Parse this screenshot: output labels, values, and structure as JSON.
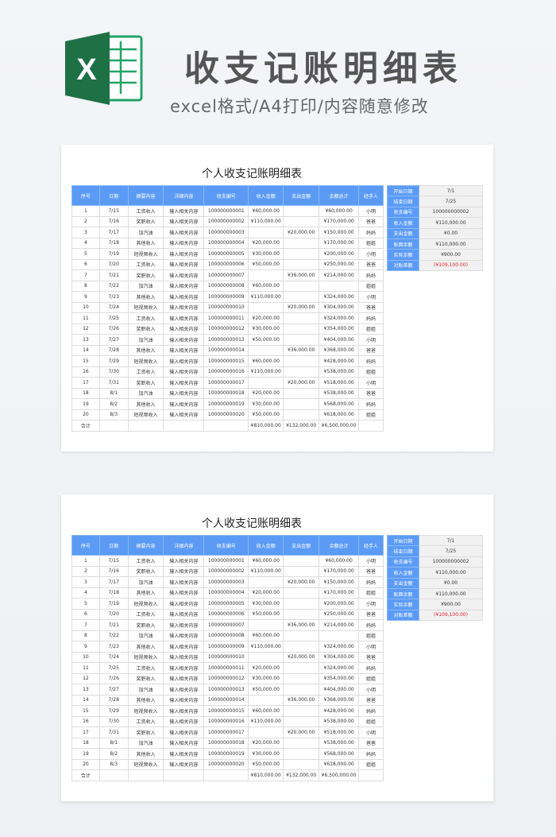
{
  "header": {
    "title": "收支记账明细表",
    "subtitle": "excel格式/A4打印/内容随意修改",
    "logo_letter": "X"
  },
  "sheet": {
    "title": "个人收支记账明细表",
    "columns": [
      "序号",
      "日期",
      "摘要内容",
      "详细内容",
      "收支编号",
      "收入金额",
      "支出金额",
      "余额总计",
      "经手人"
    ],
    "rows": [
      [
        "1",
        "7/15",
        "工资收入",
        "输入相关内容",
        "100000000001",
        "¥60,000.00",
        "",
        "¥60,000.00",
        "小明"
      ],
      [
        "2",
        "7/16",
        "奖职收入",
        "输入相关内容",
        "100000000002",
        "¥110,000.00",
        "",
        "¥170,000.00",
        "爸爸"
      ],
      [
        "3",
        "7/17",
        "加汽油",
        "输入相关内容",
        "100000000003",
        "",
        "¥20,000.00",
        "¥150,000.00",
        "妈妈"
      ],
      [
        "4",
        "7/18",
        "其他收入",
        "输入相关内容",
        "100000000004",
        "¥20,000.00",
        "",
        "¥170,000.00",
        "姐姐"
      ],
      [
        "5",
        "7/19",
        "短视频收入",
        "输入相关内容",
        "100000000005",
        "¥30,000.00",
        "",
        "¥200,000.00",
        "小明"
      ],
      [
        "6",
        "7/20",
        "工资收入",
        "输入相关内容",
        "100000000006",
        "¥50,000.00",
        "",
        "¥250,000.00",
        "爸爸"
      ],
      [
        "7",
        "7/21",
        "奖职收入",
        "输入相关内容",
        "100000000007",
        "",
        "¥36,000.00",
        "¥214,000.00",
        "妈妈"
      ],
      [
        "8",
        "7/22",
        "加汽油",
        "输入相关内容",
        "100000000008",
        "¥60,000.00",
        "",
        "",
        "姐姐"
      ],
      [
        "9",
        "7/23",
        "其他收入",
        "输入相关内容",
        "100000000009",
        "¥110,000.00",
        "",
        "¥324,000.00",
        "小明"
      ],
      [
        "10",
        "7/24",
        "短视频收入",
        "输入相关内容",
        "100000000010",
        "",
        "¥20,000.00",
        "¥304,000.00",
        "爸爸"
      ],
      [
        "11",
        "7/25",
        "工资收入",
        "输入相关内容",
        "100000000011",
        "¥20,000.00",
        "",
        "¥324,000.00",
        "妈妈"
      ],
      [
        "12",
        "7/26",
        "奖职收入",
        "输入相关内容",
        "100000000012",
        "¥30,000.00",
        "",
        "¥354,000.00",
        "姐姐"
      ],
      [
        "13",
        "7/27",
        "加汽油",
        "输入相关内容",
        "100000000013",
        "¥50,000.00",
        "",
        "¥404,000.00",
        "小明"
      ],
      [
        "14",
        "7/28",
        "其他收入",
        "输入相关内容",
        "100000000014",
        "",
        "¥36,000.00",
        "¥368,000.00",
        "爸爸"
      ],
      [
        "15",
        "7/29",
        "短视频收入",
        "输入相关内容",
        "100000000015",
        "¥60,000.00",
        "",
        "¥428,000.00",
        "妈妈"
      ],
      [
        "16",
        "7/30",
        "工资收入",
        "输入相关内容",
        "100000000016",
        "¥110,000.00",
        "",
        "¥538,000.00",
        "姐姐"
      ],
      [
        "17",
        "7/31",
        "奖职收入",
        "输入相关内容",
        "100000000017",
        "",
        "¥20,000.00",
        "¥518,000.00",
        "小明"
      ],
      [
        "18",
        "8/1",
        "加汽油",
        "输入相关内容",
        "100000000018",
        "¥20,000.00",
        "",
        "¥538,000.00",
        "爸爸"
      ],
      [
        "19",
        "8/2",
        "其他收入",
        "输入相关内容",
        "100000000019",
        "¥30,000.00",
        "",
        "¥568,000.00",
        "妈妈"
      ],
      [
        "20",
        "8/3",
        "短视频收入",
        "输入相关内容",
        "100000000020",
        "¥50,000.00",
        "",
        "¥618,000.00",
        "姐姐"
      ]
    ],
    "total": [
      "合计",
      "",
      "",
      "",
      "",
      "¥810,000.00",
      "¥132,000.00",
      "¥6,500,000.00",
      ""
    ],
    "summary": [
      {
        "label": "开始日期",
        "value": "7/1"
      },
      {
        "label": "结束日期",
        "value": "7/25"
      },
      {
        "label": "收支编号",
        "value": "100000000002"
      },
      {
        "label": "收入金额",
        "value": "¥110,000.00"
      },
      {
        "label": "支出金额",
        "value": "¥0.00"
      },
      {
        "label": "账面余额",
        "value": "¥110,000.00"
      },
      {
        "label": "实际余额",
        "value": "¥900.00"
      },
      {
        "label": "对账差额",
        "value": "(¥109,100.00)",
        "negative": true
      }
    ]
  },
  "colors": {
    "header_blue": "#5b9bf5",
    "excel_green": "#1e7145",
    "negative_red": "#e0202a"
  }
}
